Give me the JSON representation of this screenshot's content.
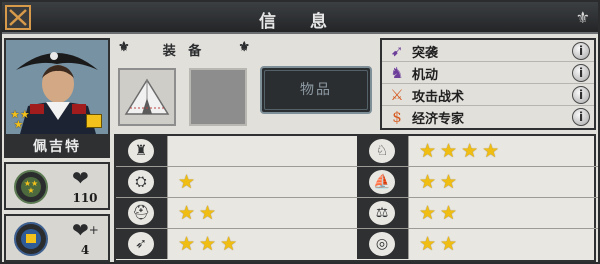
{
  "window": {
    "title": "信 息",
    "close_label": "✕"
  },
  "general": {
    "name": "佩吉特",
    "rank_stars": "★★\n★",
    "hp": "110",
    "hp_icon": "heart-icon",
    "reserve": "4",
    "reserve_icon": "heart-plus-icon"
  },
  "equipment": {
    "title": "装 备",
    "items_button": "物品",
    "slots": [
      "tent",
      "empty"
    ]
  },
  "traits": [
    {
      "label": "突袭",
      "icon": "raid-icon",
      "color": "#6d3f9a"
    },
    {
      "label": "机动",
      "icon": "horse-icon",
      "color": "#6d3f9a"
    },
    {
      "label": "攻击战术",
      "icon": "crossed-swords-icon",
      "color": "#d55b22"
    },
    {
      "label": "经济专家",
      "icon": "dollar-icon",
      "color": "#d55b22"
    }
  ],
  "skills": {
    "left": [
      {
        "icon": "infantry-icon",
        "stars": 0
      },
      {
        "icon": "artillery-icon",
        "stars": 1
      },
      {
        "icon": "cavalry-helmet-icon",
        "stars": 2
      },
      {
        "icon": "archer-icon",
        "stars": 3
      }
    ],
    "right": [
      {
        "icon": "horse-head-icon",
        "stars": 4
      },
      {
        "icon": "ship-icon",
        "stars": 2
      },
      {
        "icon": "balance-icon",
        "stars": 2
      },
      {
        "icon": "target-icon",
        "stars": 2
      }
    ]
  },
  "colors": {
    "accent": "#d79a4a",
    "star": "#f0bd12",
    "panel": "#e2e0db",
    "dark": "#2e3032"
  }
}
